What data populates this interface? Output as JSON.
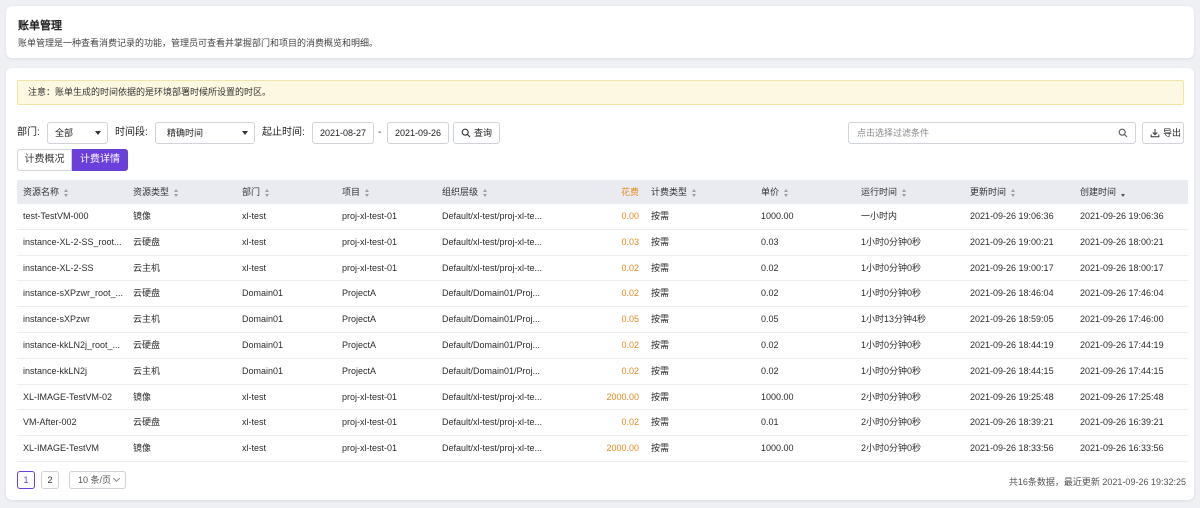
{
  "header": {
    "title": "账单管理",
    "description": "账单管理是一种查看消费记录的功能，管理员可查看并掌握部门和项目的消费概览和明细。"
  },
  "notice": "注意：账单生成的时间依据的是环境部署时候所设置的时区。",
  "filters": {
    "department_label": "部门:",
    "department_value": "全部",
    "period_label": "时间段:",
    "period_value": "精确时间",
    "range_label": "起止时间:",
    "start_date": "2021-08-27",
    "range_separator": "-",
    "end_date": "2021-09-26",
    "query_button": "查询",
    "search_placeholder": "点击选择过滤条件",
    "export_button": "导出"
  },
  "tabs": {
    "overview": "计费概况",
    "detail": "计费详情"
  },
  "table": {
    "columns": {
      "name": "资源名称",
      "type": "资源类型",
      "department": "部门",
      "project": "项目",
      "org": "组织层级",
      "cost": "花费",
      "billing": "计费类型",
      "price": "单价",
      "runtime": "运行时间",
      "updated": "更新时间",
      "created": "创建时间"
    },
    "rows": [
      {
        "name": "test-TestVM-000",
        "type": "镜像",
        "department": "xl-test",
        "project": "proj-xl-test-01",
        "org": "Default/xl-test/proj-xl-te...",
        "cost": "0.00",
        "billing": "按需",
        "price": "1000.00",
        "runtime": "一小时内",
        "updated": "2021-09-26 19:06:36",
        "created": "2021-09-26 19:06:36"
      },
      {
        "name": "instance-XL-2-SS_root...",
        "type": "云硬盘",
        "department": "xl-test",
        "project": "proj-xl-test-01",
        "org": "Default/xl-test/proj-xl-te...",
        "cost": "0.03",
        "billing": "按需",
        "price": "0.03",
        "runtime": "1小时0分钟0秒",
        "updated": "2021-09-26 19:00:21",
        "created": "2021-09-26 18:00:21"
      },
      {
        "name": "instance-XL-2-SS",
        "type": "云主机",
        "department": "xl-test",
        "project": "proj-xl-test-01",
        "org": "Default/xl-test/proj-xl-te...",
        "cost": "0.02",
        "billing": "按需",
        "price": "0.02",
        "runtime": "1小时0分钟0秒",
        "updated": "2021-09-26 19:00:17",
        "created": "2021-09-26 18:00:17"
      },
      {
        "name": "instance-sXPzwr_root_...",
        "type": "云硬盘",
        "department": "Domain01",
        "project": "ProjectA",
        "org": "Default/Domain01/Proj...",
        "cost": "0.02",
        "billing": "按需",
        "price": "0.02",
        "runtime": "1小时0分钟0秒",
        "updated": "2021-09-26 18:46:04",
        "created": "2021-09-26 17:46:04"
      },
      {
        "name": "instance-sXPzwr",
        "type": "云主机",
        "department": "Domain01",
        "project": "ProjectA",
        "org": "Default/Domain01/Proj...",
        "cost": "0.05",
        "billing": "按需",
        "price": "0.05",
        "runtime": "1小时13分钟4秒",
        "updated": "2021-09-26 18:59:05",
        "created": "2021-09-26 17:46:00"
      },
      {
        "name": "instance-kkLN2j_root_...",
        "type": "云硬盘",
        "department": "Domain01",
        "project": "ProjectA",
        "org": "Default/Domain01/Proj...",
        "cost": "0.02",
        "billing": "按需",
        "price": "0.02",
        "runtime": "1小时0分钟0秒",
        "updated": "2021-09-26 18:44:19",
        "created": "2021-09-26 17:44:19"
      },
      {
        "name": "instance-kkLN2j",
        "type": "云主机",
        "department": "Domain01",
        "project": "ProjectA",
        "org": "Default/Domain01/Proj...",
        "cost": "0.02",
        "billing": "按需",
        "price": "0.02",
        "runtime": "1小时0分钟0秒",
        "updated": "2021-09-26 18:44:15",
        "created": "2021-09-26 17:44:15"
      },
      {
        "name": "XL-IMAGE-TestVM-02",
        "type": "镜像",
        "department": "xl-test",
        "project": "proj-xl-test-01",
        "org": "Default/xl-test/proj-xl-te...",
        "cost": "2000.00",
        "billing": "按需",
        "price": "1000.00",
        "runtime": "2小时0分钟0秒",
        "updated": "2021-09-26 19:25:48",
        "created": "2021-09-26 17:25:48"
      },
      {
        "name": "VM-After-002",
        "type": "云硬盘",
        "department": "xl-test",
        "project": "proj-xl-test-01",
        "org": "Default/xl-test/proj-xl-te...",
        "cost": "0.02",
        "billing": "按需",
        "price": "0.01",
        "runtime": "2小时0分钟0秒",
        "updated": "2021-09-26 18:39:21",
        "created": "2021-09-26 16:39:21"
      },
      {
        "name": "XL-IMAGE-TestVM",
        "type": "镜像",
        "department": "xl-test",
        "project": "proj-xl-test-01",
        "org": "Default/xl-test/proj-xl-te...",
        "cost": "2000.00",
        "billing": "按需",
        "price": "1000.00",
        "runtime": "2小时0分钟0秒",
        "updated": "2021-09-26 18:33:56",
        "created": "2021-09-26 16:33:56"
      }
    ]
  },
  "pagination": {
    "pages": [
      "1",
      "2"
    ],
    "current": "1",
    "page_size": "10 条/页",
    "summary": "共16条数据，最近更新 2021-09-26 19:32:25"
  },
  "colors": {
    "accent": "#6b3fd9",
    "cost": "#e6891f",
    "notice_bg": "#fdf8e1"
  }
}
